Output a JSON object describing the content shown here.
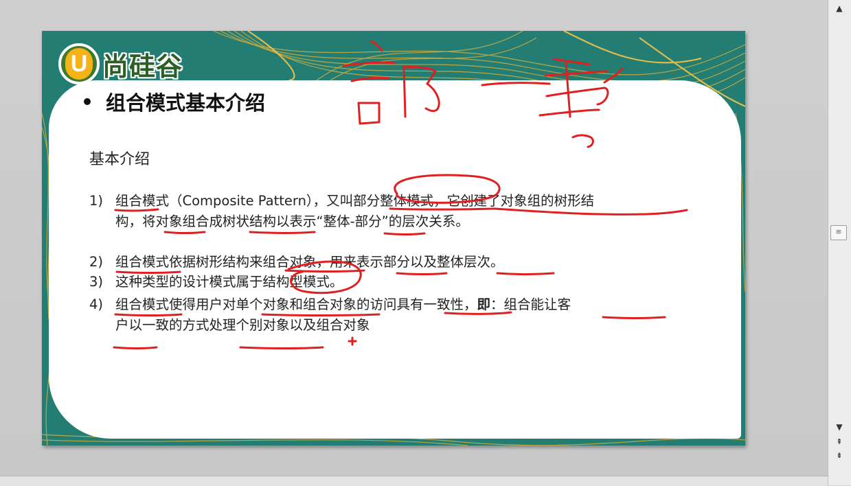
{
  "slide": {
    "logo_text": "尚硅谷",
    "logo_letter": "U",
    "title": "组合模式基本介绍",
    "subheading": "基本介绍",
    "items": [
      {
        "num": "1)",
        "line1": "组合模式（Composite Pattern），又叫部分整体模式，它创建了对象组的树形结",
        "line2": "构，将对象组合成树状结构以表示“整体-部分”的层次关系。"
      },
      {
        "num": "2)",
        "line1": "组合模式依据树形结构来组合对象，用来表示部分以及整体层次。"
      },
      {
        "num": "3)",
        "line1": "这种类型的设计模式属于结构型模式。"
      },
      {
        "num": "4)",
        "line1a": "组合模式使得用户对单个对象和组合对象的访问具有一致性，",
        "line1b": "即",
        "line1c": "：组合能让客",
        "line2": "户以一致的方式处理个别对象以及组合对象"
      }
    ]
  },
  "scrollbar": {
    "up_icon": "triangle-up",
    "down_icon": "triangle-down",
    "prev_page_icon": "double-chevron-up",
    "next_page_icon": "double-chevron-down",
    "thumb_grip": "≡"
  },
  "colors": {
    "slide_bg": "#237d73",
    "accent_gold": "#f5b318",
    "logo_green": "#3d7a2c",
    "annotation_ink": "#e02020"
  }
}
